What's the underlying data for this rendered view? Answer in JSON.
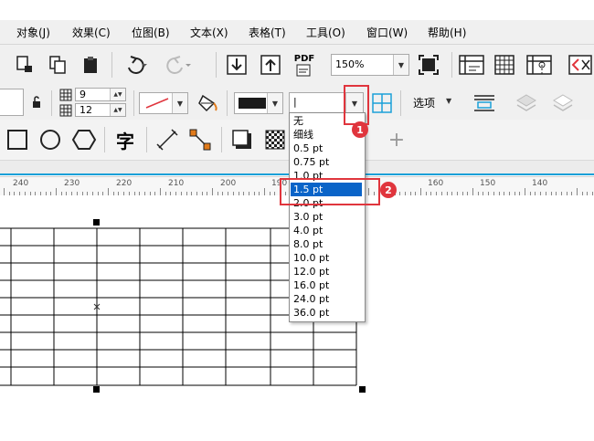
{
  "menu": [
    "对象(J)",
    "效果(C)",
    "位图(B)",
    "文本(X)",
    "表格(T)",
    "工具(O)",
    "窗口(W)",
    "帮助(H)"
  ],
  "toolbar1": {
    "pdf_label": "PDF",
    "zoom_value": "150%"
  },
  "toolbar2": {
    "rows_value": "9",
    "cols_value": "12",
    "outline_width_value": "|",
    "options_label": "选项"
  },
  "toolbar3": {
    "text_tool_glyph": "字",
    "add_glyph": "+"
  },
  "ruler": {
    "labels": [
      "240",
      "230",
      "220",
      "210",
      "200",
      "190",
      "160",
      "150",
      "140"
    ]
  },
  "dropdown": {
    "items": [
      "无",
      "细线",
      "0.5 pt",
      "0.75 pt",
      "1.0 pt",
      "1.5 pt",
      "2.0 pt",
      "3.0 pt",
      "4.0 pt",
      "8.0 pt",
      "10.0 pt",
      "12.0 pt",
      "16.0 pt",
      "24.0 pt",
      "36.0 pt"
    ],
    "selected": "1.5 pt"
  },
  "annotations": {
    "badge1": "1",
    "badge2": "2"
  },
  "colors": {
    "accent": "#0a64c8",
    "annotation": "#e0353d",
    "ruler_line": "#1aa0d8"
  }
}
